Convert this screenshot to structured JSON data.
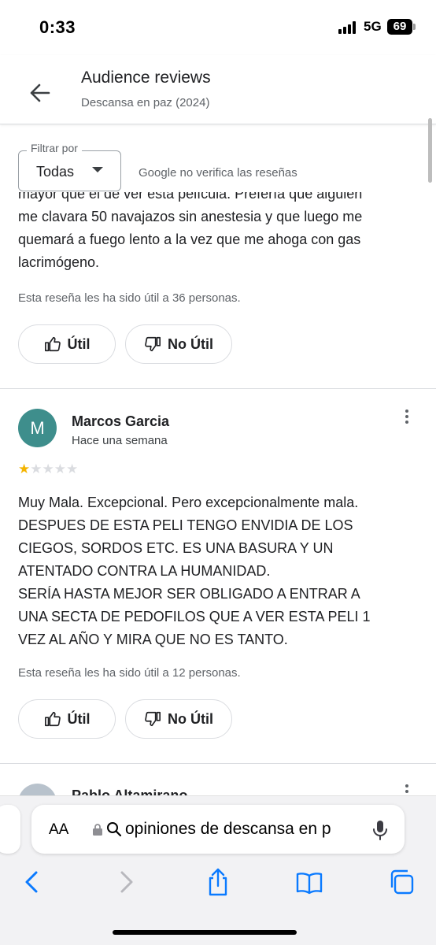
{
  "status": {
    "time": "0:33",
    "network": "5G",
    "battery": "69"
  },
  "header": {
    "title": "Audience reviews",
    "subtitle": "Descansa en paz (2024)"
  },
  "filter": {
    "legend": "Filtrar por",
    "value": "Todas",
    "note": "Google no verifica las reseñas"
  },
  "review_1": {
    "text_partial": "mayor que el de ver esta película. Prefería que alguien\nme clavara 50 navajazos sin anestesia y que luego me\nquemará a fuego lento a la vez que me ahoga con gas\nlacrimógeno.",
    "helpful": "Esta reseña les ha sido útil a 36 personas.",
    "useful_label": "Útil",
    "not_useful_label": "No Útil"
  },
  "review_2": {
    "avatar_letter": "M",
    "author": "Marcos Garcia",
    "when": "Hace una semana",
    "rating": 1,
    "rating_max": 5,
    "text": "Muy Mala. Excepcional. Pero excepcionalmente mala.\nDESPUES DE ESTA PELI TENGO ENVIDIA DE LOS\nCIEGOS, SORDOS ETC. ES UNA BASURA Y UN\nATENTADO CONTRA LA HUMANIDAD.\nSERÍA HASTA MEJOR SER OBLIGADO A ENTRAR A\nUNA SECTA DE PEDOFILOS QUE A VER ESTA PELI 1\nVEZ AL AÑO Y MIRA QUE NO ES TANTO.",
    "helpful": "Esta reseña les ha sido útil a 12 personas.",
    "useful_label": "Útil",
    "not_useful_label": "No Útil"
  },
  "review_3": {
    "author_partial": "Pablo Altamirano"
  },
  "safari": {
    "aa_label": "AA",
    "url_text": "opiniones de descansa en p"
  },
  "colors": {
    "avatar": "#3e8e8c",
    "star_on": "#f4b400",
    "ios_blue": "#0a7aff"
  }
}
